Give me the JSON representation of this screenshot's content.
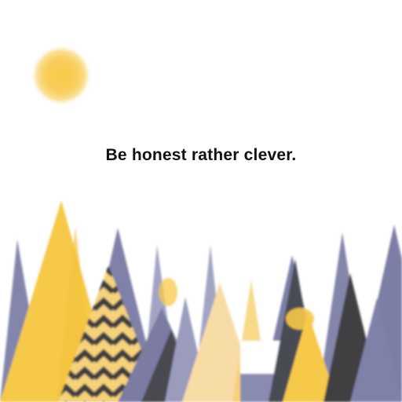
{
  "quote": {
    "text": "Be honest rather clever."
  },
  "palette": {
    "background": "#ffffff",
    "sun": "#f7c948",
    "yellow": "#f7c948",
    "pale_yellow": "#f8dca6",
    "slate": "#7d7ea6",
    "slate_light": "#9a9bbd",
    "charcoal": "#3f4142",
    "text": "#111111"
  },
  "scene": {
    "elements": [
      "sun",
      "quote",
      "stylized-mountains"
    ]
  }
}
